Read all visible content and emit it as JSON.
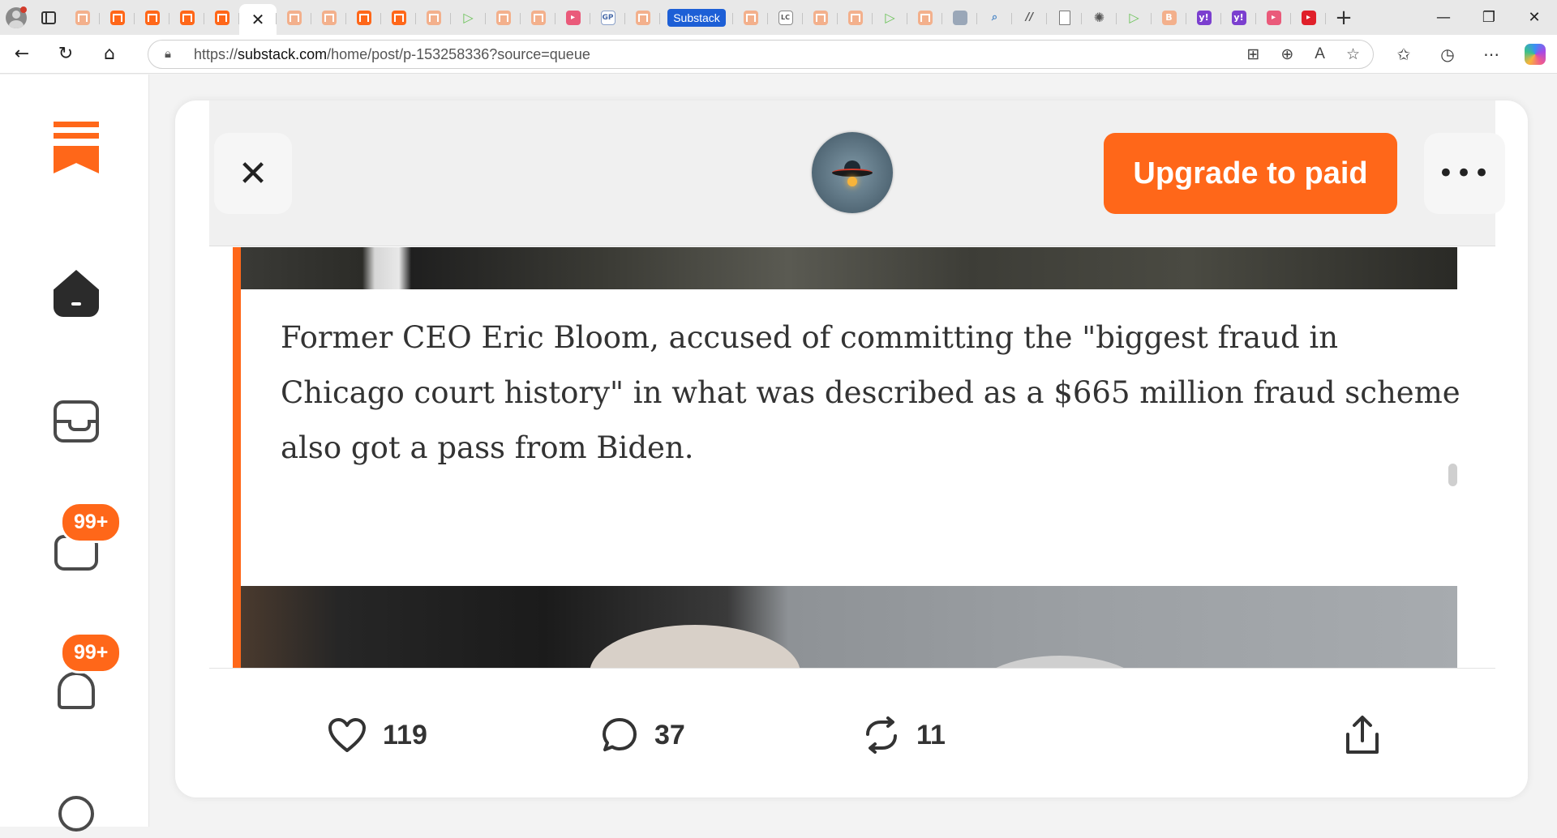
{
  "browser": {
    "active_tab_label": "Substack",
    "url_prefix": "https://",
    "url_host": "substack.com",
    "url_path": "/home/post/p-153258336?source=queue"
  },
  "rail": {
    "messages_badge": "99+",
    "notifications_badge": "99+"
  },
  "header": {
    "upgrade_label": "Upgrade to paid"
  },
  "post": {
    "quote": "Former CEO Eric Bloom, accused of committing the \"biggest fraud in Chicago court history\" in what was described as a $665 million fraud scheme also got a pass from Biden."
  },
  "actions": {
    "likes": "119",
    "comments": "37",
    "restacks": "11"
  },
  "colors": {
    "accent": "#ff6719",
    "tab_highlight": "#1d5fd6"
  }
}
